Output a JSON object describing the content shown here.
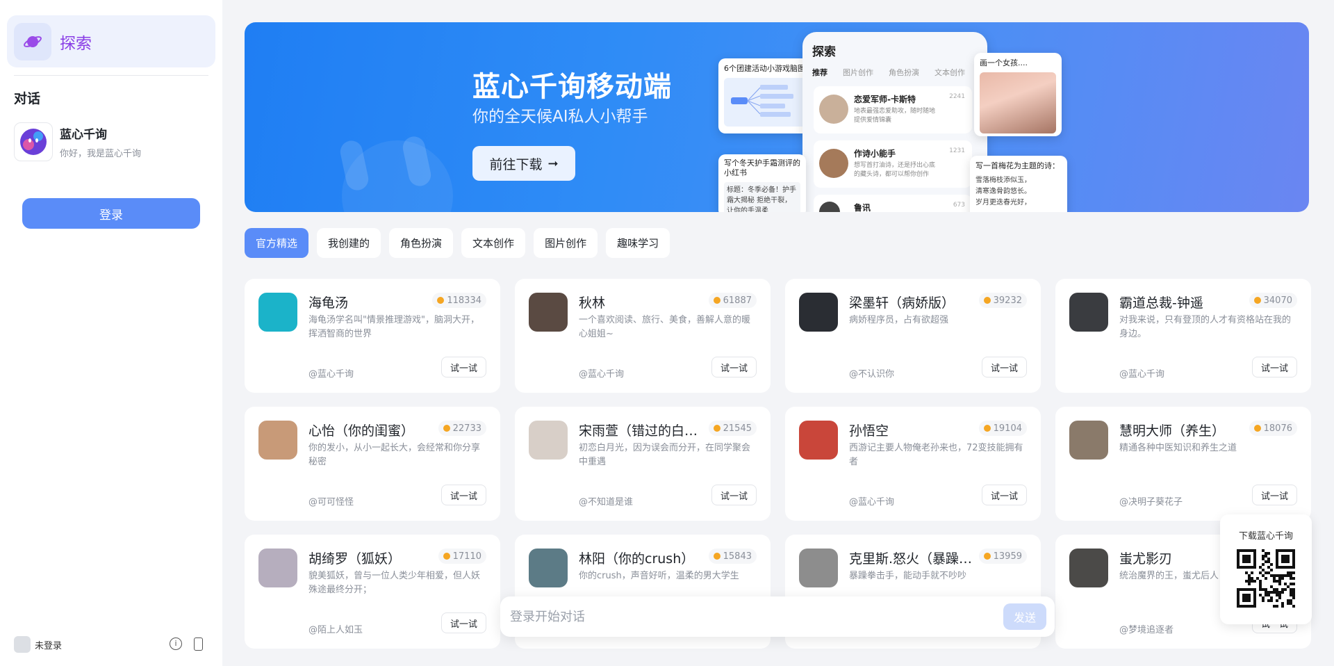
{
  "sidebar": {
    "explore_label": "探索",
    "section_title": "对话",
    "chat": {
      "name": "蓝心千询",
      "preview": "你好，我是蓝心千询"
    },
    "login_label": "登录",
    "user_status": "未登录"
  },
  "banner": {
    "title": "蓝心千询移动端",
    "subtitle": "你的全天候AI私人小帮手",
    "button_label": "前往下载",
    "phone": {
      "title": "探索",
      "tabs": [
        "推荐",
        "图片创作",
        "角色扮演",
        "文本创作"
      ],
      "rows": [
        {
          "name": "恋爱军师-卡斯特",
          "desc": "地表最强恋爱助攻，随时随地提供爱情锦囊",
          "count": "2241"
        },
        {
          "name": "作诗小能手",
          "desc": "想写首打油诗，还是抒出心底的藏头诗，都可以帮你创作",
          "count": "1231"
        },
        {
          "name": "鲁讯",
          "desc": "",
          "count": "673"
        }
      ]
    },
    "float_mind": "6个团建活动小游戏脑图",
    "float_note_title": "写个冬天护手霜测评的小红书",
    "float_note_body": "标题：冬季必备！护手霜大揭秘 拒绝干裂，让你的手温柔",
    "float_girl_title": "画一个女孩....",
    "float_poem_title": "写一首梅花为主题的诗：",
    "float_poem_lines": [
      "雪落梅枝添似玉，",
      "清寒逸骨韵悠长。",
      "岁月更迭春光好，"
    ]
  },
  "tabs": [
    "官方精选",
    "我创建的",
    "角色扮演",
    "文本创作",
    "图片创作",
    "趣味学习"
  ],
  "try_label": "试一试",
  "cards": [
    {
      "name": "海龟汤",
      "count": "118334",
      "desc": "海龟汤学名叫\"情景推理游戏\"，脑洞大开，挥洒智商的世界",
      "author": "@蓝心千询",
      "color": "#1bb3c9"
    },
    {
      "name": "秋林",
      "count": "61887",
      "desc": "一个喜欢阅读、旅行、美食，善解人意的暖心姐姐~",
      "author": "@蓝心千询",
      "color": "#5a4a42"
    },
    {
      "name": "梁墨轩（病娇版）",
      "count": "39232",
      "desc": "病娇程序员，占有欲超强",
      "author": "@不认识你",
      "color": "#2a2d33"
    },
    {
      "name": "霸道总裁-钟遥",
      "count": "34070",
      "desc": "对我来说，只有登顶的人才有资格站在我的身边。",
      "author": "@蓝心千询",
      "color": "#3a3c40"
    },
    {
      "name": "心怡（你的闺蜜）",
      "count": "22733",
      "desc": "你的发小，从小一起长大，会经常和你分享秘密",
      "author": "@可可怪怪",
      "color": "#c89a78"
    },
    {
      "name": "宋雨萱（错过的白月光）",
      "count": "21545",
      "desc": "初恋白月光，因为误会而分开，在同学聚会中重遇",
      "author": "@不知道是谁",
      "color": "#d8cfc8"
    },
    {
      "name": "孙悟空",
      "count": "19104",
      "desc": "西游记主要人物俺老孙来也，72变技能拥有者",
      "author": "@蓝心千询",
      "color": "#c9463a"
    },
    {
      "name": "慧明大师（养生）",
      "count": "18076",
      "desc": "精通各种中医知识和养生之道",
      "author": "@决明子葵花子",
      "color": "#8a7a6a"
    },
    {
      "name": "胡绮罗（狐妖）",
      "count": "17110",
      "desc": "貌美狐妖，曾与一位人类少年相爱，但人妖殊途最终分开；",
      "author": "@陌上人如玉",
      "color": "#b6aebe"
    },
    {
      "name": "林阳（你的crush）",
      "count": "15843",
      "desc": "你的crush，声音好听，温柔的男大学生",
      "author": "",
      "color": "#5c7b86"
    },
    {
      "name": "克里斯.怒火（暴躁拳击手）",
      "count": "13959",
      "desc": "暴躁拳击手，能动手就不吵吵",
      "author": "",
      "color": "#8d8d8d"
    },
    {
      "name": "蚩尤影刃",
      "count": "",
      "desc": "统治魔界的王，蚩尤后人",
      "author": "@梦境追逐者",
      "color": "#4b4a48"
    }
  ],
  "input": {
    "placeholder": "登录开始对话",
    "send_label": "发送"
  },
  "qr": {
    "title": "下载蓝心千询"
  },
  "colors": {
    "accent": "#5a8cf8",
    "explore_text": "#8a3ee6",
    "coin": "#f5a623"
  }
}
